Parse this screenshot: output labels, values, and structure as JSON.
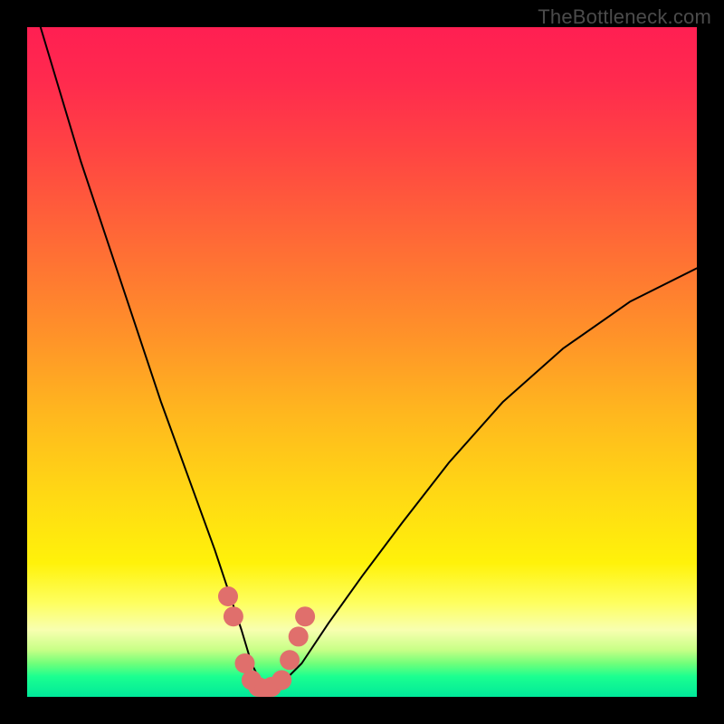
{
  "watermark": "TheBottleneck.com",
  "chart_data": {
    "type": "line",
    "title": "",
    "xlabel": "",
    "ylabel": "",
    "xlim": [
      0,
      100
    ],
    "ylim": [
      0,
      100
    ],
    "grid": false,
    "series": [
      {
        "name": "bottleneck-curve",
        "x": [
          2,
          5,
          8,
          12,
          16,
          20,
          24,
          28,
          30,
          32,
          33.5,
          35,
          36.5,
          38,
          41,
          45,
          50,
          56,
          63,
          71,
          80,
          90,
          100
        ],
        "values": [
          100,
          90,
          80,
          68,
          56,
          44,
          33,
          22,
          16,
          10,
          5,
          2,
          1,
          2,
          5,
          11,
          18,
          26,
          35,
          44,
          52,
          59,
          64
        ]
      }
    ],
    "markers": {
      "name": "highlight-dots",
      "color": "#e06f6c",
      "x": [
        30,
        30.8,
        32.5,
        33.5,
        34.5,
        35.5,
        36.5,
        38.0,
        39.2,
        40.5,
        41.5
      ],
      "values": [
        15,
        12,
        5,
        2.5,
        1.5,
        1.2,
        1.5,
        2.5,
        5.5,
        9,
        12
      ]
    },
    "gradient_stops": [
      {
        "pct": 0,
        "color": "#ff1f52"
      },
      {
        "pct": 18,
        "color": "#ff4343"
      },
      {
        "pct": 46,
        "color": "#ff9229"
      },
      {
        "pct": 70,
        "color": "#ffd914"
      },
      {
        "pct": 86,
        "color": "#feff60"
      },
      {
        "pct": 93,
        "color": "#c7ff86"
      },
      {
        "pct": 100,
        "color": "#00e89a"
      }
    ]
  }
}
